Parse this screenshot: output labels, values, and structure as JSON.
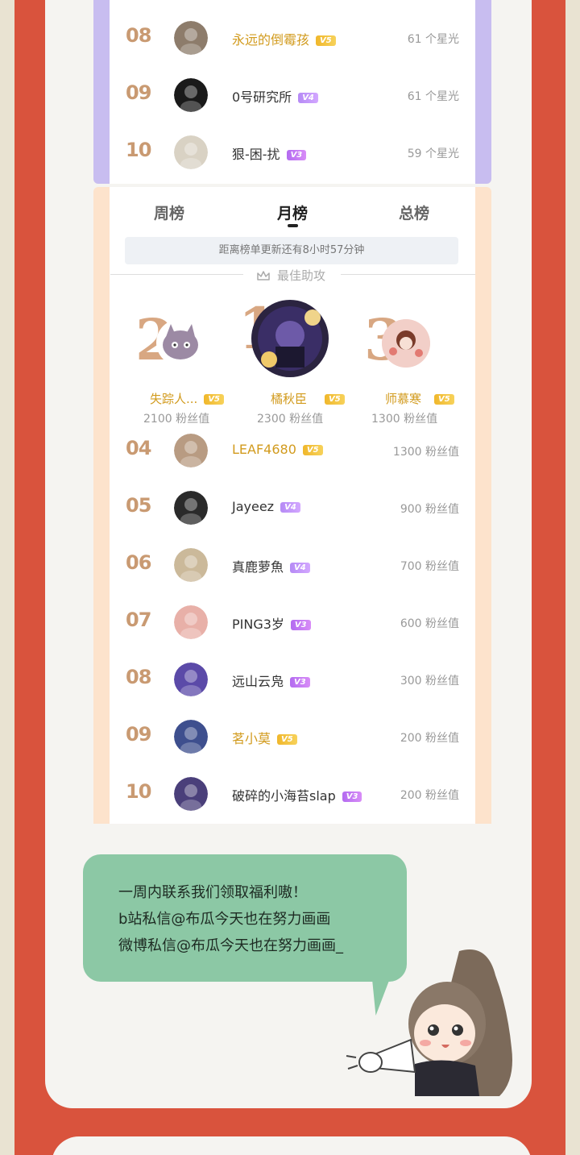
{
  "top_list": [
    {
      "rank": "08",
      "name": "永远的倒霉孩",
      "name_gold": true,
      "level": "V5",
      "value": "61 个星光"
    },
    {
      "rank": "09",
      "name": "0号研究所",
      "name_gold": false,
      "level": "V4",
      "value": "61 个星光"
    },
    {
      "rank": "10",
      "name": "狠-困-扰",
      "name_gold": false,
      "level": "V3",
      "value": "59 个星光"
    }
  ],
  "tabs": {
    "weekly": "周榜",
    "monthly": "月榜",
    "total": "总榜"
  },
  "countdown": "距离榜单更新还有8小时57分钟",
  "section_title": "最佳助攻",
  "podium": [
    {
      "rank": "2",
      "name": "失踪人...",
      "level": "V5",
      "value": "2100 粉丝值"
    },
    {
      "rank": "1",
      "name": "橘秋臣",
      "level": "V5",
      "value": "2300 粉丝值"
    },
    {
      "rank": "3",
      "name": "师慕寒",
      "level": "V5",
      "value": "1300 粉丝值"
    }
  ],
  "list": [
    {
      "rank": "04",
      "name": "LEAF4680",
      "name_gold": true,
      "level": "V5",
      "value": "1300 粉丝值"
    },
    {
      "rank": "05",
      "name": "Jayeez",
      "name_gold": false,
      "level": "V4",
      "value": "900 粉丝值"
    },
    {
      "rank": "06",
      "name": "真鹿萝魚",
      "name_gold": false,
      "level": "V4",
      "value": "700 粉丝值"
    },
    {
      "rank": "07",
      "name": "PING3岁",
      "name_gold": false,
      "level": "V3",
      "value": "600 粉丝值"
    },
    {
      "rank": "08",
      "name": "远山云凫",
      "name_gold": false,
      "level": "V3",
      "value": "300 粉丝值"
    },
    {
      "rank": "09",
      "name": "茗小莫",
      "name_gold": true,
      "level": "V5",
      "value": "200 粉丝值"
    },
    {
      "rank": "10",
      "name": "破碎的小海苔slap",
      "name_gold": false,
      "level": "V3",
      "value": "200 粉丝值"
    }
  ],
  "bubble": {
    "line1": "一周内联系我们领取福利嗷！",
    "line2": "b站私信@布瓜今天也在努力画画",
    "line3": "微博私信@布瓜今天也在努力画画_"
  },
  "colors": {
    "rank": "#c99a72",
    "gold": "#d29b1e",
    "accent_red": "#d9533d",
    "bubble": "#8cc8a5"
  }
}
